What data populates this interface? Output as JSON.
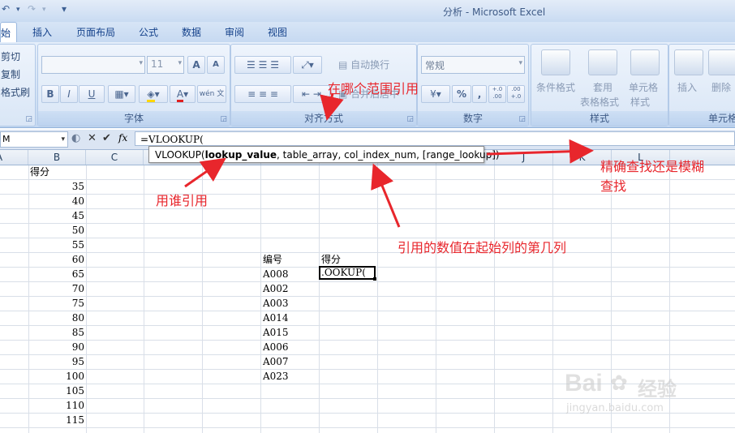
{
  "window": {
    "title": "分析 - Microsoft Excel",
    "qat_undo": "↶",
    "qat_redo": "↷",
    "qat_menu": "▾"
  },
  "tabs": [
    "始",
    "插入",
    "页面布局",
    "公式",
    "数据",
    "审阅",
    "视图"
  ],
  "ribbon": {
    "clipboard": {
      "cut": "剪切",
      "copy": "复制",
      "format_painter": "格式刷"
    },
    "font": {
      "label": "字体",
      "size": "11",
      "grow": "A",
      "shrink": "A",
      "bold": "B",
      "italic": "I",
      "underline": "U",
      "wen": "wén 文"
    },
    "alignment": {
      "label": "对齐方式",
      "wrap": "自动换行",
      "merge": "合并后居中"
    },
    "number": {
      "label": "数字",
      "format": "常规",
      "percent": "%",
      "comma": ",",
      "inc": "+.0 .00",
      "dec": ".00 +.0"
    },
    "styles": {
      "label": "样式",
      "conditional": "条件格式",
      "table_format_1": "套用",
      "table_format_2": "表格格式",
      "cell_style_1": "单元格",
      "cell_style_2": "样式"
    },
    "cells": {
      "label": "单元格",
      "insert": "插入",
      "delete": "删除"
    }
  },
  "formula_bar": {
    "name_box": "M",
    "cancel": "✕",
    "enter": "✔",
    "fx": "fx",
    "formula": "=VLOOKUP("
  },
  "columns": [
    "A",
    "B",
    "C",
    "J",
    "K",
    "L"
  ],
  "column_b_header": "得分",
  "scores": [
    "35",
    "40",
    "45",
    "50",
    "55",
    "60",
    "65",
    "70",
    "75",
    "80",
    "85",
    "90",
    "95",
    "100",
    "105",
    "110",
    "115"
  ],
  "lookup_table": {
    "id_header": "编号",
    "score_header": "得分",
    "ids": [
      "A008",
      "A002",
      "A003",
      "A014",
      "A015",
      "A006",
      "A007",
      "A023"
    ],
    "active_cell_text": ".OOKUP("
  },
  "tooltip": {
    "func": "VLOOKUP(",
    "arg1": "lookup_value",
    "rest": ", table_array, col_index_num, [range_lookup])"
  },
  "annotations": {
    "range": "在哪个范围引用",
    "who": "用谁引用",
    "column": "引用的数值在起始列的第几列",
    "exact_1": "精确查找还是模糊",
    "exact_2": "查找"
  },
  "watermark": {
    "brand": "Bai",
    "brand2": "经验",
    "url": "jingyan.baidu.com"
  }
}
